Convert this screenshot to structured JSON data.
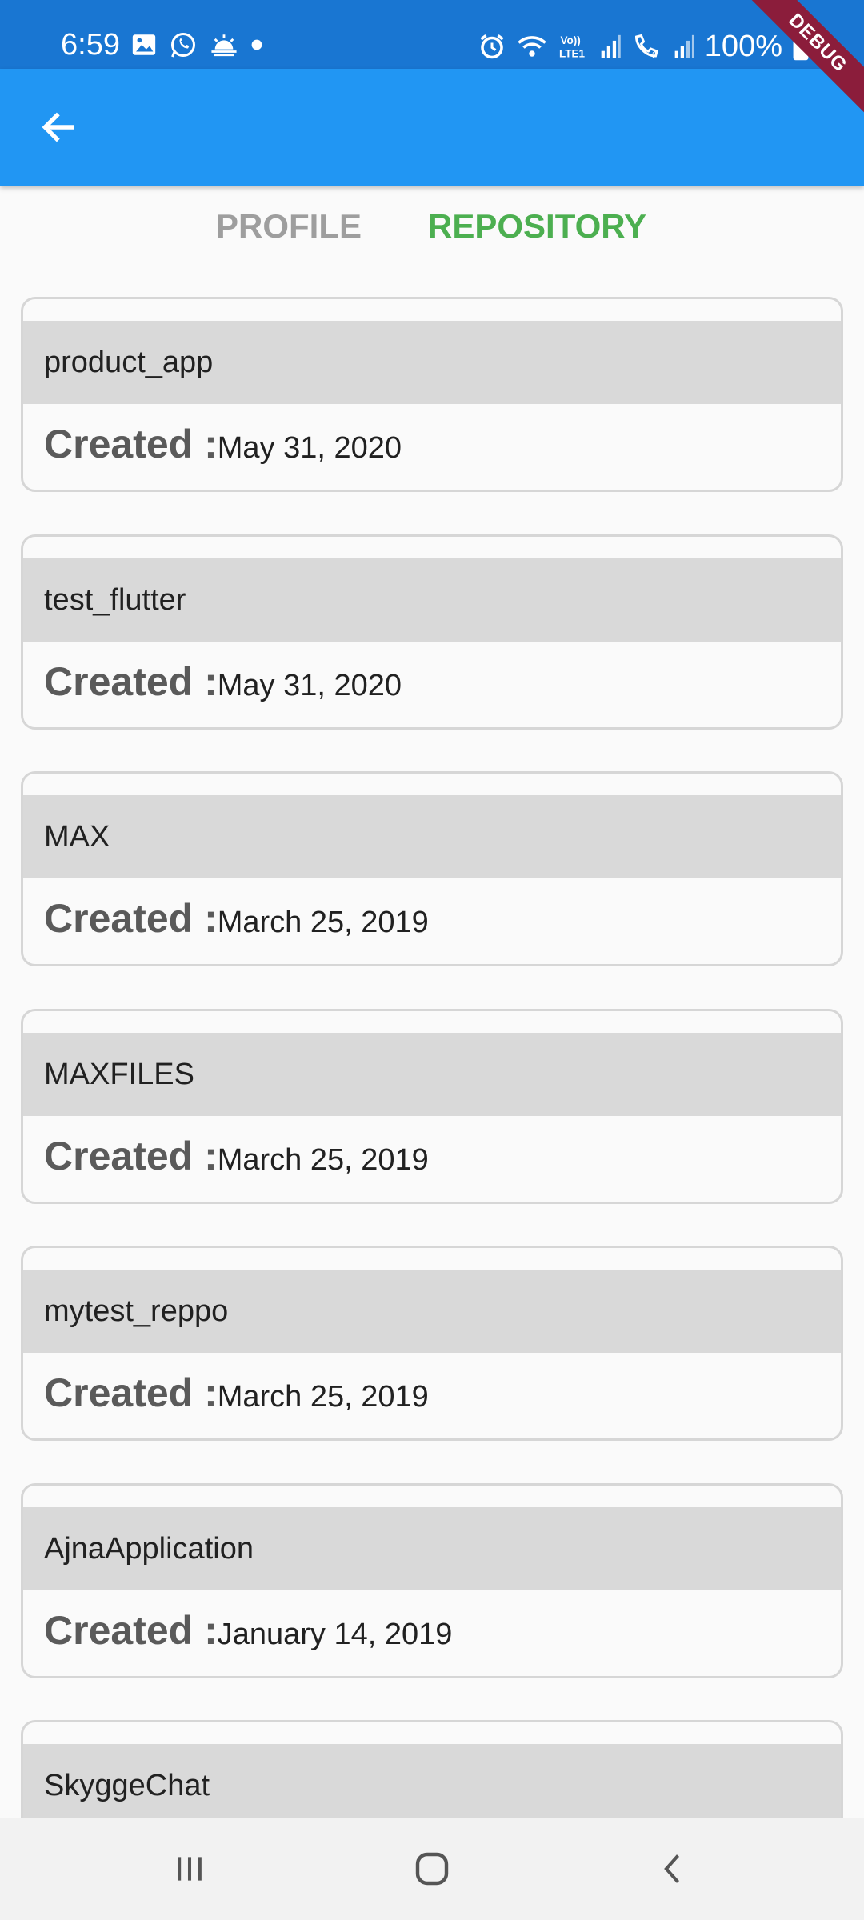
{
  "status_bar": {
    "time": "6:59",
    "battery": "100%",
    "left_icons": [
      "image-icon",
      "whatsapp-icon",
      "weather-icon",
      "dot-icon"
    ],
    "right_icons": [
      "alarm-icon",
      "wifi-icon",
      "volte-icon",
      "signal-icon",
      "call-icon",
      "signal2-icon",
      "battery-icon"
    ],
    "volte_text": "Vo)) LTE1",
    "background": "#1976d2"
  },
  "debug_banner": "DEBUG",
  "app_bar": {
    "color": "#2196f3",
    "back_icon": "arrow-left-icon"
  },
  "tabs": [
    {
      "label": "PROFILE",
      "active": false,
      "color": "#9e9e9e"
    },
    {
      "label": "REPOSITORY",
      "active": true,
      "color": "#4caf50"
    }
  ],
  "repositories": [
    {
      "name": "product_app",
      "created_label": "Created :",
      "created_date": "May 31, 2020"
    },
    {
      "name": "test_flutter",
      "created_label": "Created :",
      "created_date": "May 31, 2020"
    },
    {
      "name": "MAX",
      "created_label": "Created :",
      "created_date": "March 25, 2019"
    },
    {
      "name": "MAXFILES",
      "created_label": "Created :",
      "created_date": "March 25, 2019"
    },
    {
      "name": "mytest_reppo",
      "created_label": "Created :",
      "created_date": "March 25, 2019"
    },
    {
      "name": "AjnaApplication",
      "created_label": "Created :",
      "created_date": "January 14, 2019"
    },
    {
      "name": "SkyggeChat"
    }
  ],
  "nav_bar": {
    "buttons": [
      "recent-apps-icon",
      "home-icon",
      "back-icon"
    ]
  }
}
